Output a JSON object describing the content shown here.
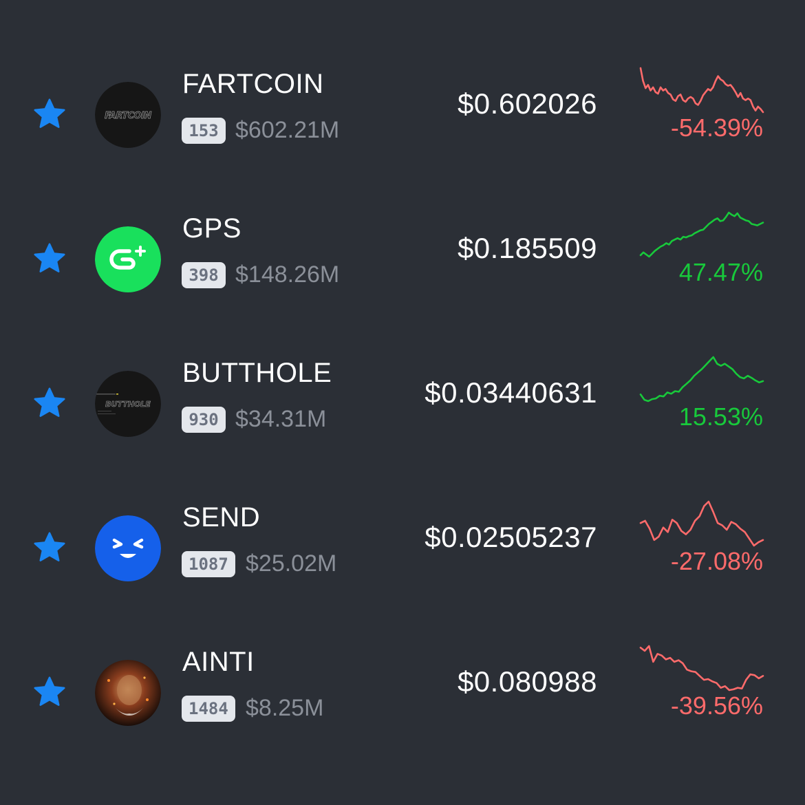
{
  "colors": {
    "background": "#2b2f36",
    "star": "#1a86f3",
    "negative": "#ff6b6b",
    "positive": "#18c93b",
    "rank_bg": "#e4e7ec",
    "rank_text": "#6b7280",
    "muted": "#8b9099"
  },
  "tokens": [
    {
      "name": "FARTCOIN",
      "rank": "153",
      "market_cap": "$602.21M",
      "price": "$0.602026",
      "change": "-54.39%",
      "direction": "down",
      "logo_icon": "fartcoin-logo-icon",
      "logo_text": "FARTCOIN",
      "sparkline": [
        88,
        72,
        63,
        67,
        60,
        64,
        58,
        56,
        64,
        60,
        62,
        57,
        55,
        49,
        47,
        53,
        55,
        48,
        46,
        50,
        52,
        50,
        44,
        42,
        47,
        54,
        58,
        62,
        60,
        64,
        72,
        78,
        74,
        72,
        68,
        66,
        67,
        63,
        58,
        52,
        57,
        50,
        48,
        50,
        48,
        40,
        35,
        40,
        37,
        33
      ]
    },
    {
      "name": "GPS",
      "rank": "398",
      "market_cap": "$148.26M",
      "price": "$0.185509",
      "change": "47.47%",
      "direction": "up",
      "logo_icon": "gps-logo-icon",
      "logo_text": "",
      "sparkline": [
        36,
        40,
        37,
        34,
        38,
        42,
        45,
        48,
        50,
        53,
        51,
        56,
        58,
        60,
        58,
        62,
        61,
        63,
        64,
        67,
        69,
        71,
        72,
        76,
        80,
        83,
        86,
        88,
        84,
        85,
        90,
        96,
        93,
        91,
        95,
        89,
        87,
        85,
        84,
        80,
        79,
        78,
        80,
        82
      ]
    },
    {
      "name": "BUTTHOLE",
      "rank": "930",
      "market_cap": "$34.31M",
      "price": "$0.03440631",
      "change": "15.53%",
      "direction": "up",
      "logo_icon": "butthole-logo-icon",
      "logo_text": "BUTTHOLE",
      "sparkline": [
        30,
        22,
        20,
        23,
        24,
        28,
        27,
        33,
        31,
        35,
        34,
        41,
        46,
        51,
        58,
        63,
        68,
        74,
        80,
        86,
        76,
        73,
        76,
        72,
        68,
        61,
        56,
        54,
        58,
        55,
        51,
        48,
        50
      ]
    },
    {
      "name": "SEND",
      "rank": "1087",
      "market_cap": "$25.02M",
      "price": "$0.02505237",
      "change": "-27.08%",
      "direction": "down",
      "logo_icon": "send-logo-icon",
      "logo_text": "",
      "sparkline": [
        60,
        62,
        55,
        45,
        48,
        56,
        52,
        63,
        60,
        53,
        50,
        54,
        62,
        66,
        75,
        79,
        70,
        60,
        58,
        54,
        61,
        59,
        55,
        52,
        46,
        40,
        43,
        45
      ]
    },
    {
      "name": "AINTI",
      "rank": "1484",
      "market_cap": "$8.25M",
      "price": "$0.080988",
      "change": "-39.56%",
      "direction": "down",
      "logo_icon": "ainti-logo-icon",
      "logo_text": "",
      "sparkline": [
        86,
        82,
        88,
        68,
        78,
        76,
        71,
        73,
        68,
        70,
        66,
        58,
        56,
        55,
        50,
        45,
        46,
        43,
        41,
        35,
        37,
        32,
        33,
        35,
        34,
        45,
        52,
        51,
        47,
        50
      ]
    }
  ]
}
